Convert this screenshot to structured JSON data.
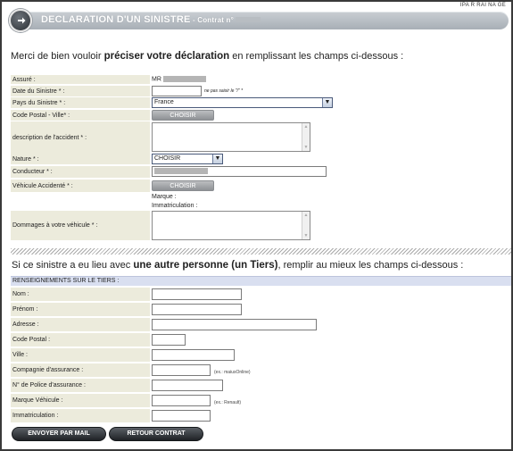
{
  "top_note": "IPA R RAI NA GE",
  "banner": {
    "title": "DECLARATION D'UN SINISTRE",
    "subtitle": " - Contrat n°"
  },
  "intro": {
    "part1": "Merci de bien vouloir ",
    "bold": "préciser votre déclaration",
    "part2": " en remplissant les champs ci-dessous :"
  },
  "form": {
    "assure_label": "Assuré :",
    "assure_value": "MR",
    "date_label": "Date du Sinistre * :",
    "date_hint": "ne pas saisir le \"/\" *",
    "pays_label": "Pays du Sinistre * :",
    "pays_value": "France",
    "cp_label": "Code Postal - Ville* :",
    "choisir_btn": "CHOISIR",
    "desc_label": "description de l'accident * :",
    "nature_label": "Nature * :",
    "nature_value": "CHOISIR",
    "conducteur_label": "Conducteur * :",
    "vehicule_label": "Véhicule Accidenté * :",
    "vehicule_btn": "CHOISIR",
    "marque_label": "Marque :",
    "immat_label": "Immatriculation :",
    "dommages_label": "Dommages à votre véhicule * :"
  },
  "tiers_intro": {
    "part1": "Si ce sinistre a eu lieu avec ",
    "bold": "une autre personne (un Tiers)",
    "part2": ", remplir au mieux les champs ci-dessous :"
  },
  "tiers": {
    "section_title": "RENSEIGNEMENTS SUR LE TIERS :",
    "nom": "Nom :",
    "prenom": "Prénom :",
    "adresse": "Adresse :",
    "code_postal": "Code Postal :",
    "ville": "Ville :",
    "compagnie": "Compagnie d'assurance :",
    "compagnie_hint": "(ex.: maiusOnline)",
    "police": "N° de Police d'assurance :",
    "marque": "Marque Véhicule :",
    "marque_hint": "(ex.: Renault)",
    "immatriculation": "Immatriculation :"
  },
  "actions": {
    "send": "ENVOYER PAR MAIL",
    "back": "RETOUR CONTRAT"
  }
}
